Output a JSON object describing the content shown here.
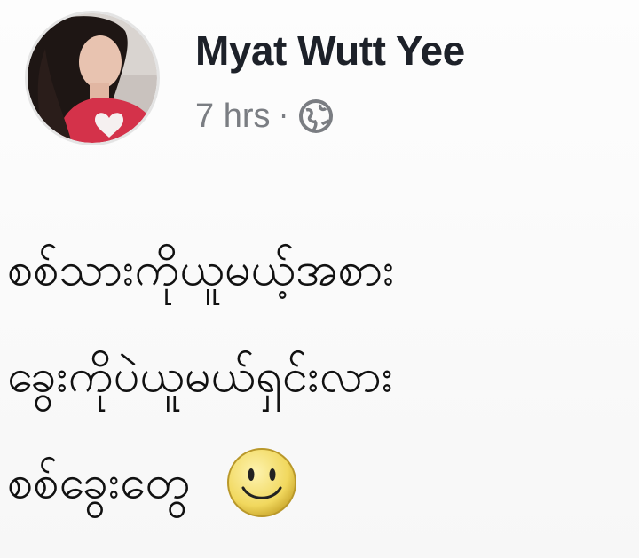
{
  "post": {
    "author": "Myat Wutt Yee",
    "timestamp": "7 hrs",
    "separator": "·",
    "privacy_icon": "globe-icon",
    "lines": [
      "စစ်သားကိုယူမယ့်အစား",
      "ခွေးကိုပဲယူမယ်ရှင်းလား",
      "စစ်ခွေးတွေ"
    ],
    "emoji": "smiley-icon"
  },
  "colors": {
    "name": "#1d2129",
    "meta": "#7a7d82",
    "smiley_fill": "#f4e07a"
  }
}
